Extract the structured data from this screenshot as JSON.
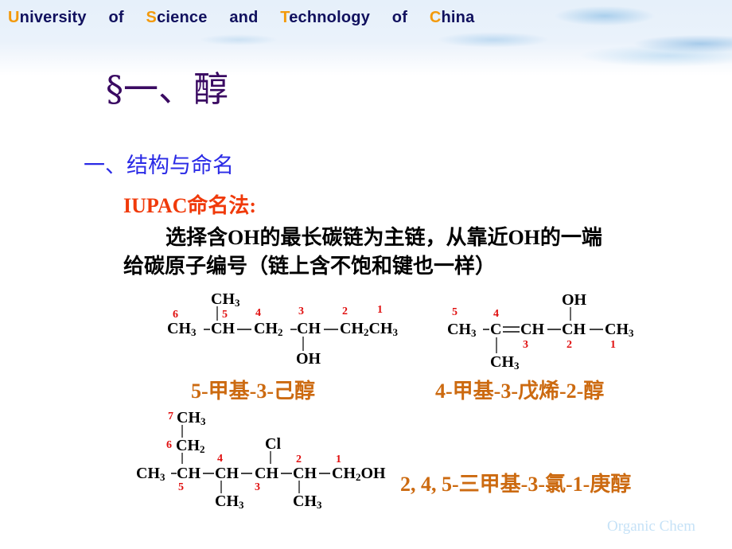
{
  "header": {
    "university_words": [
      {
        "cap": "U",
        "rest": "niversity"
      },
      {
        "cap": "",
        "rest": "of"
      },
      {
        "cap": "S",
        "rest": "cience"
      },
      {
        "cap": "",
        "rest": "and"
      },
      {
        "cap": "T",
        "rest": "echnology"
      },
      {
        "cap": "",
        "rest": "of"
      },
      {
        "cap": "C",
        "rest": "hina"
      }
    ]
  },
  "slide": {
    "title": "§一、醇",
    "section": "一、结构与命名",
    "method_label": "IUPAC命名法:",
    "rule_line1": "选择含OH的最长碳链为主链，从靠近OH的一端",
    "rule_line2": "给碳原子编号（链上含不饱和键也一样）"
  },
  "structures": {
    "s1": {
      "nums": [
        "6",
        "5",
        "4",
        "3",
        "2",
        "1"
      ],
      "top_sub": "CH",
      "top_sub_n": "3",
      "bottom_sub": "OH",
      "chain": [
        "CH",
        "3",
        "CH",
        "CH",
        "2",
        "CH",
        "CH",
        "2",
        "CH",
        "3"
      ],
      "name": "5-甲基-3-己醇"
    },
    "s2": {
      "nums": [
        "5",
        "4",
        "3",
        "2",
        "1"
      ],
      "top_sub": "OH",
      "bottom_sub": "CH",
      "bottom_sub_n": "3",
      "chain": [
        "CH",
        "3",
        "C",
        "CH",
        "CH",
        "CH",
        "3"
      ],
      "name": "4-甲基-3-戊烯-2-醇"
    },
    "s3": {
      "nums": [
        "7",
        "6",
        "5",
        "4",
        "3",
        "2",
        "1"
      ],
      "c7": "CH",
      "c7_n": "3",
      "c6": "CH",
      "c6_n": "2",
      "cl": "Cl",
      "chain": [
        "CH",
        "3",
        "CH",
        "CH",
        "CH",
        "CH",
        "CH",
        "2",
        "OH"
      ],
      "me4": "CH",
      "me4_n": "3",
      "me2": "CH",
      "me2_n": "3",
      "name": "2, 4, 5-三甲基-3-氯-1-庚醇"
    }
  },
  "footer": {
    "watermark": "Organic Chem"
  }
}
